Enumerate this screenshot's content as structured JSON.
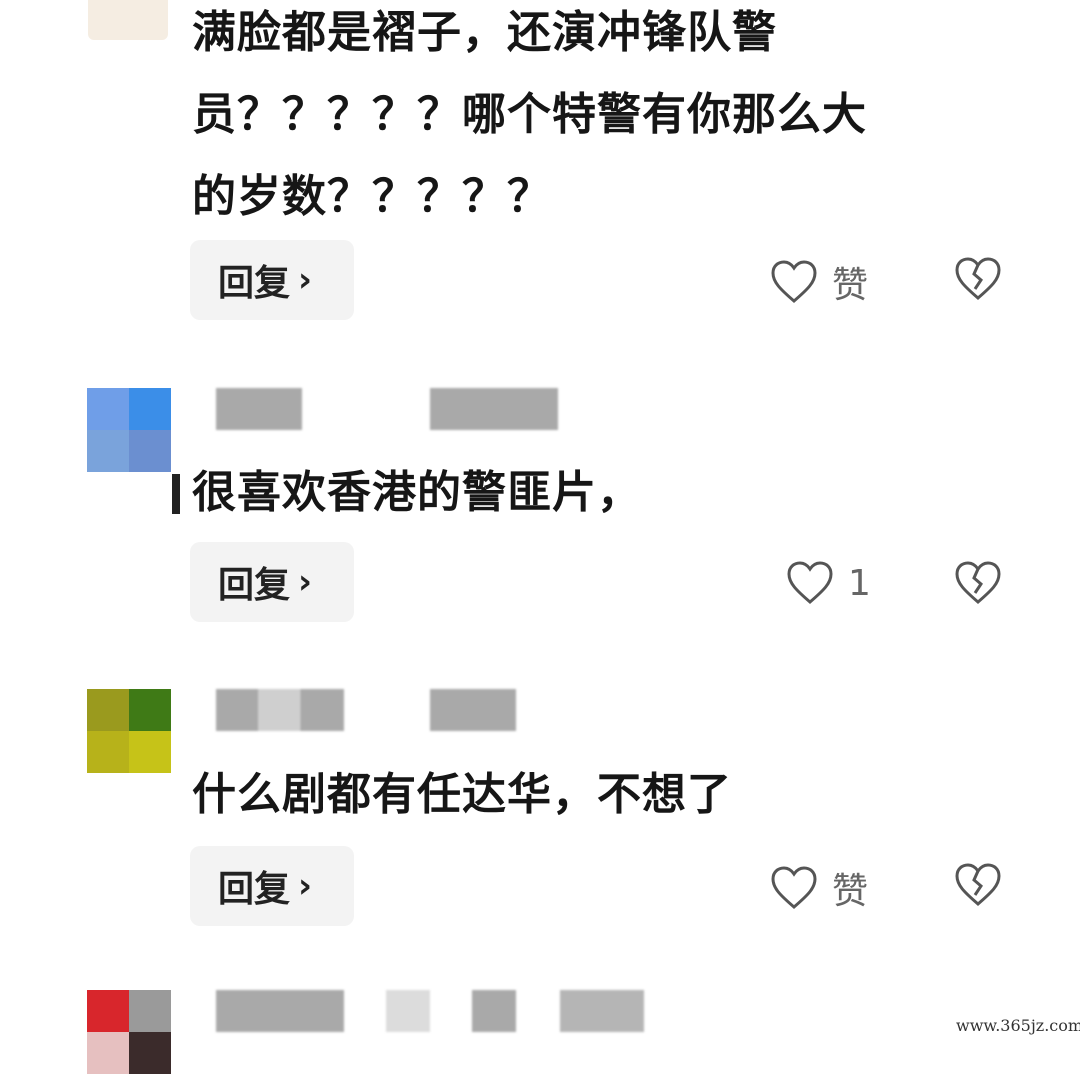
{
  "comments": [
    {
      "text": "满脸都是褶子，还演冲锋队警\n员？？？？？哪个特警有你那么大\n的岁数？？？？？",
      "reply_label": "回复",
      "like_text": "赞"
    },
    {
      "text": "很喜欢香港的警匪片，",
      "reply_label": "回复",
      "like_text": "1"
    },
    {
      "text": "什么剧都有任达华，不想了",
      "reply_label": "回复",
      "like_text": "赞"
    }
  ],
  "avatar_colors": {
    "user1": [
      "#6f9ee8",
      "#3b8ee8",
      "#7aa3db",
      "#6b8fd0"
    ],
    "user2": [
      "#9a9a1e",
      "#3f7a16",
      "#b7b21a",
      "#c6c318"
    ],
    "user3": [
      "#d8262c",
      "#9a9a9a",
      "#e6c0c0",
      "#3b2b2b"
    ]
  },
  "icons": {
    "like": "heart-outline-icon",
    "dislike": "broken-heart-icon",
    "reply": "chevron-right-icon"
  },
  "watermark": "www.365jz.com"
}
